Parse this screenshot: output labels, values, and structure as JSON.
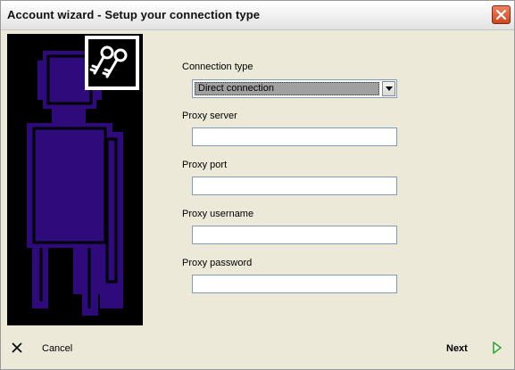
{
  "window": {
    "title": "Account wizard - Setup your connection type",
    "close_icon": "close-icon"
  },
  "sidebar": {
    "image": "user-silhouette",
    "badge_icon": "keys-icon",
    "colors": {
      "background": "#000000",
      "figure": "#2E0A7A"
    }
  },
  "form": {
    "connection_type": {
      "label": "Connection type",
      "value": "Direct connection"
    },
    "proxy_server": {
      "label": "Proxy server",
      "value": ""
    },
    "proxy_port": {
      "label": "Proxy port",
      "value": ""
    },
    "proxy_username": {
      "label": "Proxy username",
      "value": ""
    },
    "proxy_password": {
      "label": "Proxy password",
      "value": ""
    }
  },
  "footer": {
    "cancel": {
      "label": "Cancel",
      "icon": "x-icon"
    },
    "next": {
      "label": "Next",
      "icon": "play-arrow-icon",
      "icon_color": "#2EA82E"
    }
  }
}
